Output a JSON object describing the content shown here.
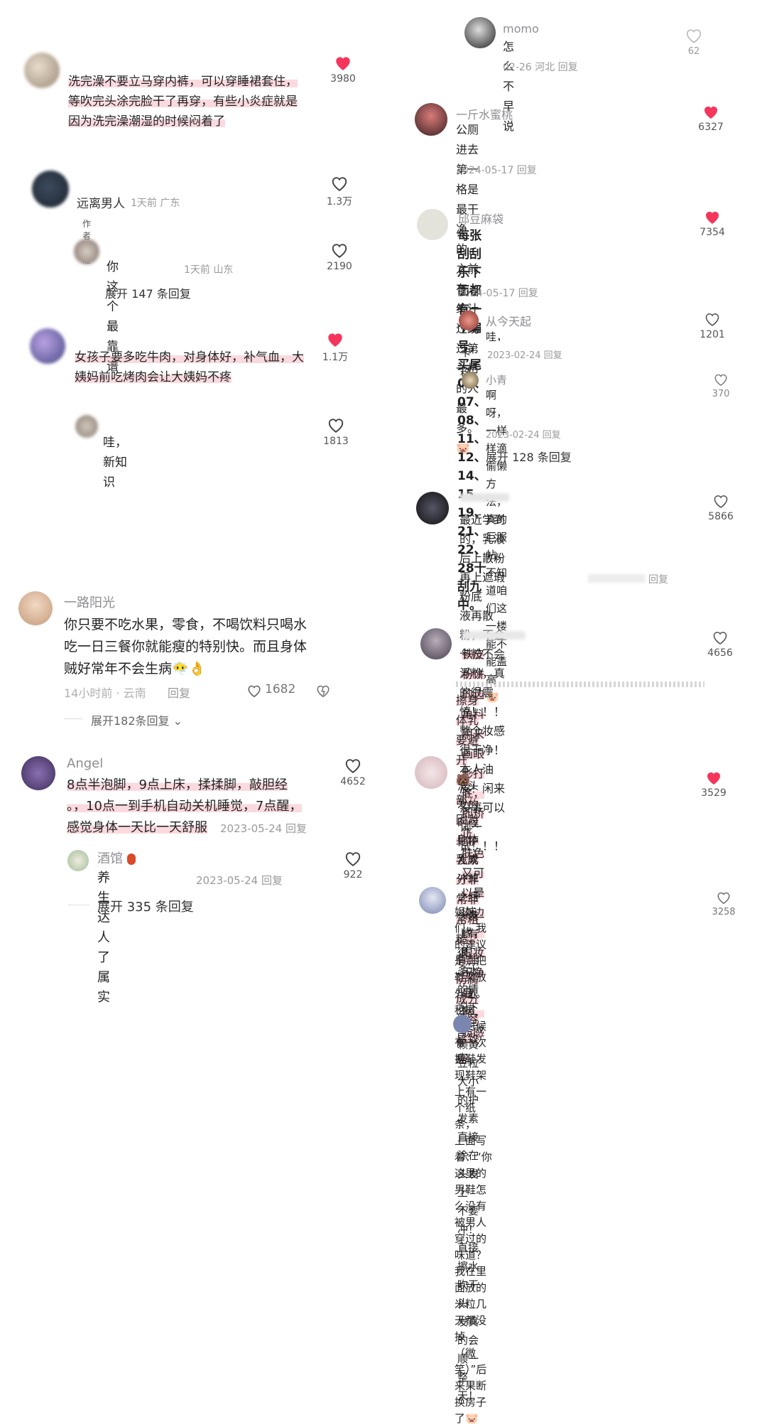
{
  "left": {
    "c1": {
      "text": "洗完澡不要立马穿内裤，可以穿睡裙套住，\n等吹完头涂完脸干了再穿，有些小炎症就是\n因为洗完澡潮湿的时候闷着了",
      "likes": "3980"
    },
    "c2": {
      "name": "远离男人",
      "meta": "1天前 广东",
      "tag": "作者赞过",
      "likes": "1.3万",
      "reply": {
        "text": "你这个最靠谱",
        "meta": "1天前 山东",
        "likes": "2190"
      },
      "more": "展开 147 条回复"
    },
    "c3": {
      "text": "女孩子要多吃牛肉，对身体好，补气血，大\n姨妈前吃烤肉会让大姨妈不疼",
      "likes": "1.1万",
      "reply": {
        "text": "哇，新知识",
        "likes": "1813"
      }
    },
    "c4": {
      "name": "一路阳光",
      "text": "你只要不吃水果，零食，不喝饮料只喝水\n吃一日三餐你就能瘦的特别快。而且身体\n贼好常年不会生病😶‍🌫️👌",
      "meta": "14小时前 · 云南",
      "reply_label": "回复",
      "likes": "1682",
      "more": "展开182条回复"
    },
    "c5": {
      "name": "Angel",
      "text": "8点半泡脚，9点上床，揉揉脚，敲胆经\n。，10点一到手机自动关机睡觉，7点醒，\n感觉身体一天比一天舒服",
      "meta": "2023-05-24 回复",
      "likes": "4652",
      "reply": {
        "name": "酒馆",
        "text": "养生达人了属实",
        "meta": "2023-05-24 回复",
        "likes": "922"
      },
      "more": "展开 335 条回复"
    }
  },
  "right": {
    "r0": {
      "name": "momo",
      "text": "怎么不早说",
      "meta": "02-26 河北 回复",
      "likes": "62"
    },
    "r1": {
      "name": "一斤水蜜桃",
      "text": "公厕进去第一格是最干净的，之前有人统计\n过跳过第一格的人最多。🐷",
      "meta": "2024-05-17 回复",
      "likes": "6327"
    },
    "r2": {
      "name": "邱豆麻袋",
      "text": "每张刮刮乐下面都有一个编号，买尾\n00、07、08、11、12、14、15、19、\n21、22、28十刮九中。",
      "meta": "2024-05-17 回复",
      "likes": "7354",
      "reply1": {
        "name": "从今天起",
        "text": "哇，太太太太太有用了",
        "tail": "卡粉",
        "meta": "2023-02-24 回复",
        "likes": "1201"
      },
      "reply2": {
        "name": "小青",
        "text": "啊呀，一样样滴偷懒方法，真的巨服帖，\n不知道咱们这一楼能不能盖高🐷",
        "meta": "2023-02-24 回复",
        "likes": "370"
      },
      "more": "展开 128 条回复"
    },
    "r3": {
      "text": "最近学到的，乳液后上散粉再上遮瑕 粉底\n液再散粉，不会卡粉不会浮粉，真的很震\n惊！！！整个妆感很干净！本人油皮！闲来\n没事可以试一试！！！",
      "meta": "回复",
      "likes": "5866"
    },
    "r4": {
      "text": "铁皮粉饼的边角料用来画眼影打底，即矫正\n肤色又可以晕染边缘，眼妆干净自然，质感",
      "text2": "擦身体乳要避开🐻部，因为身体乳成分非\n常非常粗糙，有些防腐成分还容易致癌",
      "likes": "4656"
    },
    "r5": {
      "text": "洗头发的时候把护发素冲掉之后头发上有很\n多水的情况下 挤一颗黄豆粒大小的护发素\n直接涂在头发上 不要冲！直接擦水吹干 头\n发真的会顺一整天！",
      "likes": "3529"
    },
    "r6": {
      "text": "姐妹们，我的建议是别把鞋架放外面。租房\n的时候有一次换鞋发现鞋架上有一个纸条，\n上面写着：“你这里的男鞋怎么没有被男人\n穿过的味道？我在里面放的米粒几天都没掉\n（微笑）”后来果断换房子了🐷",
      "likes": "3258"
    }
  },
  "colors": {
    "liked": "#f5365c",
    "highlight": "#f08ca0",
    "text": "#222222",
    "meta": "#9a9a9a"
  }
}
